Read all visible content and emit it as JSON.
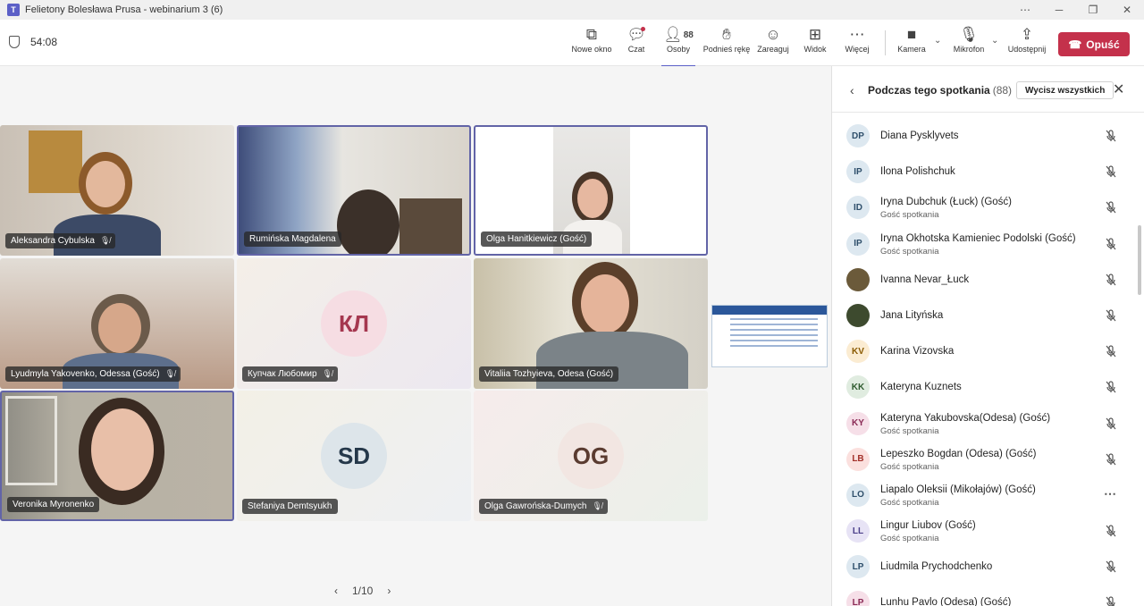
{
  "window": {
    "title": "Felietony Bolesława Prusa - webinarium 3 (6)"
  },
  "toolbar": {
    "timer": "54:08",
    "buttons": [
      {
        "label": "Nowe okno",
        "icon": "popout-icon"
      },
      {
        "label": "Czat",
        "icon": "chat-icon"
      },
      {
        "label": "Osoby",
        "icon": "people-icon",
        "badge": "88"
      },
      {
        "label": "Podnieś rękę",
        "icon": "raise-hand-icon"
      },
      {
        "label": "Zareaguj",
        "icon": "react-icon"
      },
      {
        "label": "Widok",
        "icon": "view-icon"
      },
      {
        "label": "Więcej",
        "icon": "more-icon"
      },
      {
        "label": "Kamera",
        "icon": "camera-icon"
      },
      {
        "label": "Mikrofon",
        "icon": "mic-off-icon"
      },
      {
        "label": "Udostępnij",
        "icon": "share-icon"
      }
    ],
    "leave_label": "Opuść"
  },
  "stage": {
    "tiles": [
      {
        "name": "Aleksandra Cybulska",
        "muted": true
      },
      {
        "name": "Rumińska Magdalena",
        "muted": false
      },
      {
        "name": "Olga Hanitkiewicz (Gość)",
        "muted": false
      },
      {
        "name": "Lyudmyla Yakovenko, Odessa (Gość)",
        "muted": true
      },
      {
        "name": "Купчак Любомир",
        "initials": "КЛ",
        "muted": true
      },
      {
        "name": "Vitaliia Tozhyieva, Odesa (Gość)",
        "muted": false
      },
      {
        "name": "Veronika Myronenko",
        "muted": false
      },
      {
        "name": "Stefaniya Demtsyukh",
        "initials": "SD",
        "muted": false
      },
      {
        "name": "Olga Gawrońska-Dumych",
        "initials": "OG",
        "muted": true
      }
    ],
    "pager": "1/10"
  },
  "panel": {
    "title": "Podczas tego spotkania",
    "count": "(88)",
    "mute_all_label": "Wycisz wszystkich",
    "participants": [
      {
        "initials": "DP",
        "name": "Diana Pysklyvets",
        "sub": "",
        "color": "#dde8f0",
        "fg": "#2f4f6b"
      },
      {
        "initials": "IP",
        "name": "Ilona Polishchuk",
        "sub": "",
        "color": "#dde8f0",
        "fg": "#2f4f6b"
      },
      {
        "initials": "ID",
        "name": "Iryna Dubchuk (Łuck) (Gość)",
        "sub": "Gość spotkania",
        "color": "#dde8f0",
        "fg": "#2f4f6b"
      },
      {
        "initials": "IP",
        "name": "Iryna Okhotska Kamieniec Podolski (Gość)",
        "sub": "Gość spotkania",
        "color": "#dde8f0",
        "fg": "#2f4f6b"
      },
      {
        "initials": "",
        "name": "Ivanna Nevar_Łuck",
        "sub": "",
        "color": "#6b5a3a",
        "fg": "#fff",
        "photo": true
      },
      {
        "initials": "",
        "name": "Jana Lityńska",
        "sub": "",
        "color": "#3d4a2e",
        "fg": "#fff",
        "photo": true
      },
      {
        "initials": "KV",
        "name": "Karina Vizovska",
        "sub": "",
        "color": "#fbecd2",
        "fg": "#8a5a00"
      },
      {
        "initials": "KK",
        "name": "Kateryna Kuznets",
        "sub": "",
        "color": "#e0ece0",
        "fg": "#2e5b2e"
      },
      {
        "initials": "KY",
        "name": "Kateryna Yakubovska(Odesa) (Gość)",
        "sub": "Gość spotkania",
        "color": "#f6dfe8",
        "fg": "#8a2a55"
      },
      {
        "initials": "LB",
        "name": "Lepeszko Bogdan (Odesa) (Gość)",
        "sub": "Gość spotkania",
        "color": "#fbe0de",
        "fg": "#a3312a"
      },
      {
        "initials": "LO",
        "name": "Liapalo Oleksii (Mikołajów) (Gość)",
        "sub": "Gość spotkania",
        "color": "#dde8f0",
        "fg": "#2f4f6b",
        "dots": true
      },
      {
        "initials": "LL",
        "name": "Lingur Liubov (Gość)",
        "sub": "Gość spotkania",
        "color": "#e7e3f5",
        "fg": "#4b3f8a"
      },
      {
        "initials": "LP",
        "name": "Liudmila Prychodchenko",
        "sub": "",
        "color": "#dde8f0",
        "fg": "#2f4f6b"
      },
      {
        "initials": "LP",
        "name": "Lunhu Pavlo (Odesa) (Gość)",
        "sub": "",
        "color": "#f6dfe8",
        "fg": "#8a2a55"
      }
    ]
  }
}
